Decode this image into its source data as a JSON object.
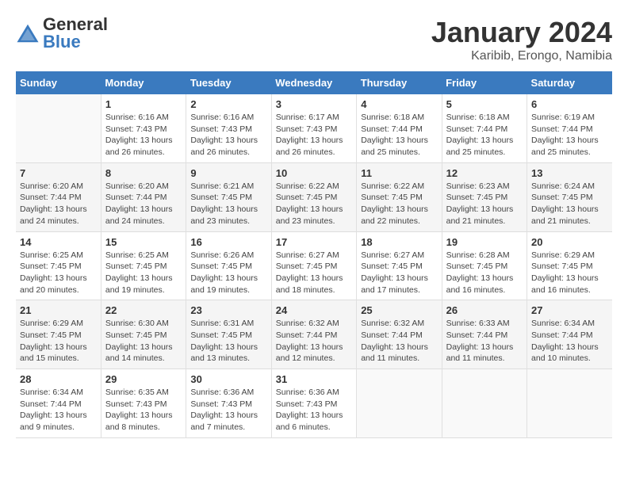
{
  "header": {
    "logo_general": "General",
    "logo_blue": "Blue",
    "month_title": "January 2024",
    "location": "Karibib, Erongo, Namibia"
  },
  "days_of_week": [
    "Sunday",
    "Monday",
    "Tuesday",
    "Wednesday",
    "Thursday",
    "Friday",
    "Saturday"
  ],
  "weeks": [
    [
      {
        "day": "",
        "info": ""
      },
      {
        "day": "1",
        "info": "Sunrise: 6:16 AM\nSunset: 7:43 PM\nDaylight: 13 hours\nand 26 minutes."
      },
      {
        "day": "2",
        "info": "Sunrise: 6:16 AM\nSunset: 7:43 PM\nDaylight: 13 hours\nand 26 minutes."
      },
      {
        "day": "3",
        "info": "Sunrise: 6:17 AM\nSunset: 7:43 PM\nDaylight: 13 hours\nand 26 minutes."
      },
      {
        "day": "4",
        "info": "Sunrise: 6:18 AM\nSunset: 7:44 PM\nDaylight: 13 hours\nand 25 minutes."
      },
      {
        "day": "5",
        "info": "Sunrise: 6:18 AM\nSunset: 7:44 PM\nDaylight: 13 hours\nand 25 minutes."
      },
      {
        "day": "6",
        "info": "Sunrise: 6:19 AM\nSunset: 7:44 PM\nDaylight: 13 hours\nand 25 minutes."
      }
    ],
    [
      {
        "day": "7",
        "info": "Sunrise: 6:20 AM\nSunset: 7:44 PM\nDaylight: 13 hours\nand 24 minutes."
      },
      {
        "day": "8",
        "info": "Sunrise: 6:20 AM\nSunset: 7:44 PM\nDaylight: 13 hours\nand 24 minutes."
      },
      {
        "day": "9",
        "info": "Sunrise: 6:21 AM\nSunset: 7:45 PM\nDaylight: 13 hours\nand 23 minutes."
      },
      {
        "day": "10",
        "info": "Sunrise: 6:22 AM\nSunset: 7:45 PM\nDaylight: 13 hours\nand 23 minutes."
      },
      {
        "day": "11",
        "info": "Sunrise: 6:22 AM\nSunset: 7:45 PM\nDaylight: 13 hours\nand 22 minutes."
      },
      {
        "day": "12",
        "info": "Sunrise: 6:23 AM\nSunset: 7:45 PM\nDaylight: 13 hours\nand 21 minutes."
      },
      {
        "day": "13",
        "info": "Sunrise: 6:24 AM\nSunset: 7:45 PM\nDaylight: 13 hours\nand 21 minutes."
      }
    ],
    [
      {
        "day": "14",
        "info": "Sunrise: 6:25 AM\nSunset: 7:45 PM\nDaylight: 13 hours\nand 20 minutes."
      },
      {
        "day": "15",
        "info": "Sunrise: 6:25 AM\nSunset: 7:45 PM\nDaylight: 13 hours\nand 19 minutes."
      },
      {
        "day": "16",
        "info": "Sunrise: 6:26 AM\nSunset: 7:45 PM\nDaylight: 13 hours\nand 19 minutes."
      },
      {
        "day": "17",
        "info": "Sunrise: 6:27 AM\nSunset: 7:45 PM\nDaylight: 13 hours\nand 18 minutes."
      },
      {
        "day": "18",
        "info": "Sunrise: 6:27 AM\nSunset: 7:45 PM\nDaylight: 13 hours\nand 17 minutes."
      },
      {
        "day": "19",
        "info": "Sunrise: 6:28 AM\nSunset: 7:45 PM\nDaylight: 13 hours\nand 16 minutes."
      },
      {
        "day": "20",
        "info": "Sunrise: 6:29 AM\nSunset: 7:45 PM\nDaylight: 13 hours\nand 16 minutes."
      }
    ],
    [
      {
        "day": "21",
        "info": "Sunrise: 6:29 AM\nSunset: 7:45 PM\nDaylight: 13 hours\nand 15 minutes."
      },
      {
        "day": "22",
        "info": "Sunrise: 6:30 AM\nSunset: 7:45 PM\nDaylight: 13 hours\nand 14 minutes."
      },
      {
        "day": "23",
        "info": "Sunrise: 6:31 AM\nSunset: 7:45 PM\nDaylight: 13 hours\nand 13 minutes."
      },
      {
        "day": "24",
        "info": "Sunrise: 6:32 AM\nSunset: 7:44 PM\nDaylight: 13 hours\nand 12 minutes."
      },
      {
        "day": "25",
        "info": "Sunrise: 6:32 AM\nSunset: 7:44 PM\nDaylight: 13 hours\nand 11 minutes."
      },
      {
        "day": "26",
        "info": "Sunrise: 6:33 AM\nSunset: 7:44 PM\nDaylight: 13 hours\nand 11 minutes."
      },
      {
        "day": "27",
        "info": "Sunrise: 6:34 AM\nSunset: 7:44 PM\nDaylight: 13 hours\nand 10 minutes."
      }
    ],
    [
      {
        "day": "28",
        "info": "Sunrise: 6:34 AM\nSunset: 7:44 PM\nDaylight: 13 hours\nand 9 minutes."
      },
      {
        "day": "29",
        "info": "Sunrise: 6:35 AM\nSunset: 7:43 PM\nDaylight: 13 hours\nand 8 minutes."
      },
      {
        "day": "30",
        "info": "Sunrise: 6:36 AM\nSunset: 7:43 PM\nDaylight: 13 hours\nand 7 minutes."
      },
      {
        "day": "31",
        "info": "Sunrise: 6:36 AM\nSunset: 7:43 PM\nDaylight: 13 hours\nand 6 minutes."
      },
      {
        "day": "",
        "info": ""
      },
      {
        "day": "",
        "info": ""
      },
      {
        "day": "",
        "info": ""
      }
    ]
  ]
}
